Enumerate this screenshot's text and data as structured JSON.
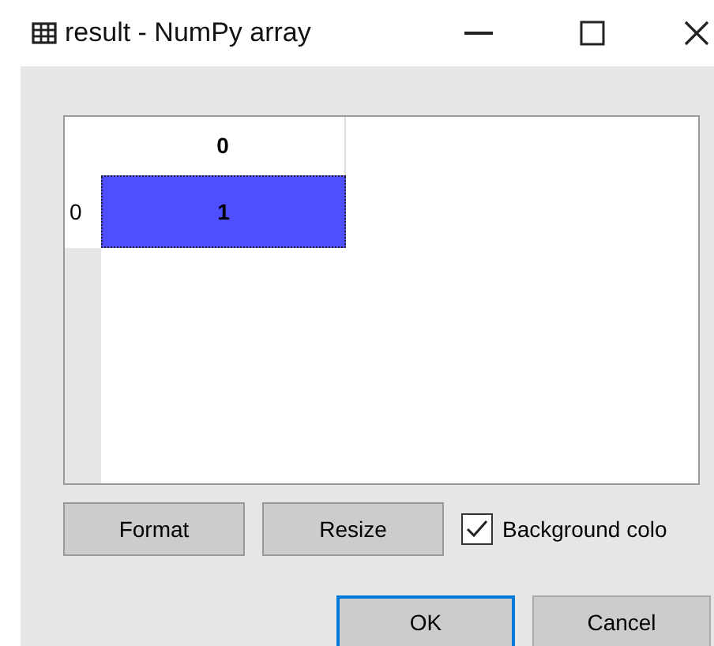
{
  "window": {
    "title": "result - NumPy array"
  },
  "table": {
    "columns": [
      "0"
    ],
    "rows": [
      {
        "header": "0",
        "cells": [
          {
            "value": "1",
            "selected": true
          }
        ]
      }
    ]
  },
  "buttons": [
    {
      "label": "Format"
    },
    {
      "label": "Resize"
    }
  ],
  "checkbox": {
    "label": "Background colo",
    "checked": true
  },
  "dialog_buttons": [
    {
      "label": "OK",
      "default": true
    },
    {
      "label": "Cancel",
      "default": false
    }
  ]
}
